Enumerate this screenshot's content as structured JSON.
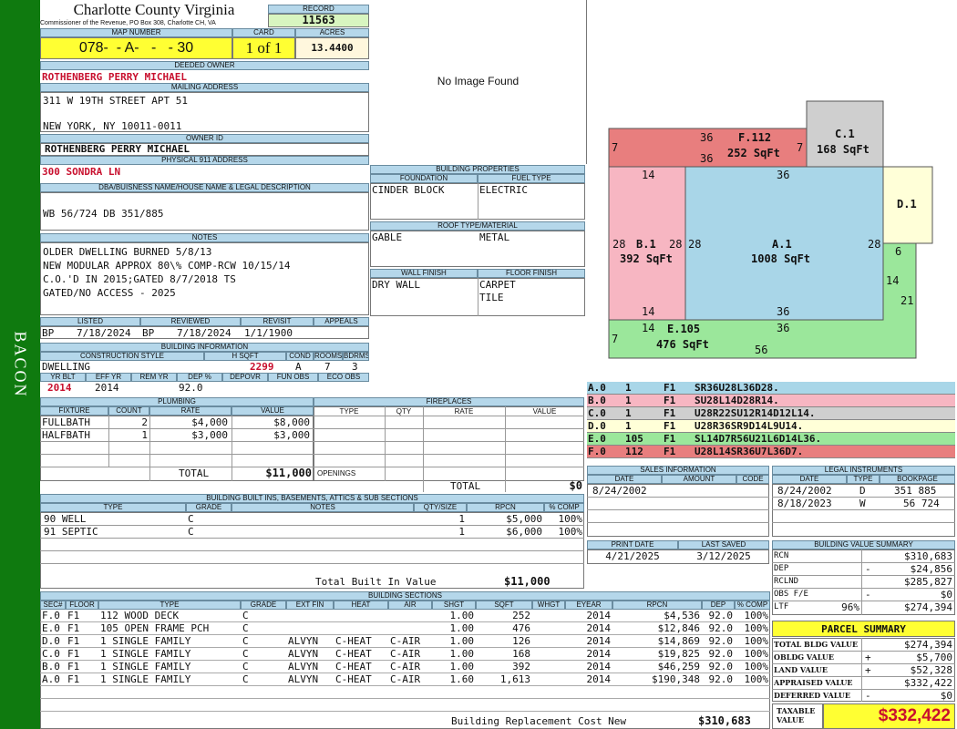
{
  "sidebar_label": "BACON",
  "county": {
    "title": "Charlotte County Virginia",
    "subtitle": "Commissioner of the Revenue, PO Box 308, Charlotte CH, VA"
  },
  "record": {
    "label": "RECORD",
    "value": "11563"
  },
  "map": {
    "label": "MAP NUMBER",
    "value": "078-  - A-   -   - 30",
    "card_label": "CARD",
    "card_value": "1 of 1",
    "acres_label": "ACRES",
    "acres_value": "13.4400"
  },
  "deeded_owner": {
    "label": "DEEDED OWNER",
    "value": "ROTHENBERG PERRY MICHAEL"
  },
  "mailing": {
    "label": "MAILING ADDRESS",
    "line1": "311 W 19TH STREET APT 51",
    "line2": "NEW YORK, NY 10011-0011"
  },
  "owner_id": {
    "label": "OWNER ID",
    "value": "ROTHENBERG PERRY MICHAEL"
  },
  "physical": {
    "label": "PHYSICAL 911 ADDRESS",
    "value": "300 SONDRA LN"
  },
  "dba": {
    "label": "DBA/BUISNESS NAME/HOUSE NAME & LEGAL DESCRIPTION",
    "value": "WB 56/724 DB 351/885"
  },
  "notes": {
    "label": "NOTES",
    "lines": [
      "OLDER DWELLING BURNED 5/8/13",
      "NEW MODULAR APPROX 80\\% COMP-RCW 10/15/14",
      "C.O.'D IN 2015;GATED 8/7/2018 TS",
      "GATED/NO ACCESS - 2025"
    ]
  },
  "listed": {
    "labels": [
      "LISTED",
      "REVIEWED",
      "REVISIT",
      "APPEALS"
    ],
    "listed_by": "BP",
    "listed_date": "7/18/2024",
    "reviewed_by": "BP",
    "reviewed_date": "7/18/2024",
    "revisit": "1/1/1900",
    "appeals": ""
  },
  "building_info": {
    "label": "BUILDING INFORMATION",
    "h_construction": "CONSTRUCTION STYLE",
    "h_hsqft": "H SQFT",
    "h_cond": "COND",
    "h_rooms": "ROOMS",
    "h_bdrms": "BDRMS",
    "style": "DWELLING",
    "hsqft": "2299",
    "cond": "A",
    "rooms": "7",
    "bdrms": "3",
    "h_yrblt": "YR BLT",
    "h_effyr": "EFF YR",
    "h_remyr": "REM YR",
    "h_dep": "DEP %",
    "h_depovr": "DEPOVR",
    "h_funobs": "FUN OBS",
    "h_ecoobs": "ECO OBS",
    "yrblt": "2014",
    "effyr": "2014",
    "remyr": "",
    "dep": "92.0",
    "depovr": "",
    "funobs": "",
    "ecoobs": ""
  },
  "plumbing": {
    "label": "PLUMBING",
    "headers": [
      "FIXTURE",
      "COUNT",
      "RATE",
      "VALUE"
    ],
    "rows": [
      [
        "FULLBATH",
        "2",
        "$4,000",
        "$8,000"
      ],
      [
        "HALFBATH",
        "1",
        "$3,000",
        "$3,000"
      ]
    ],
    "total_label": "TOTAL",
    "total": "$11,000"
  },
  "fireplaces": {
    "label": "FIREPLACES",
    "headers": [
      "TYPE",
      "QTY",
      "RATE",
      "VALUE"
    ],
    "openings_label": "OPENINGS",
    "total_label": "TOTAL",
    "total": "$0"
  },
  "photo": {
    "text": "No Image Found"
  },
  "building_props": {
    "label": "BUILDING PROPERTIES",
    "h_foundation": "FOUNDATION",
    "h_fuel": "FUEL TYPE",
    "foundation": "CINDER BLOCK",
    "fuel": "ELECTRIC",
    "h_roof": "ROOF TYPE/MATERIAL",
    "roof_type": "GABLE",
    "roof_mat": "METAL",
    "h_wall": "WALL FINISH",
    "h_floor": "FLOOR FINISH",
    "wall": "DRY WALL",
    "floor1": "CARPET",
    "floor2": "TILE"
  },
  "sketch": {
    "labels": [
      {
        "t": "F.112",
        "b": true
      },
      {
        "t": "252 SqFt",
        "b": true
      },
      {
        "t": "C.1",
        "b": true
      },
      {
        "t": "168 SqFt",
        "b": true
      },
      {
        "t": "D.1",
        "b": true
      },
      {
        "t": "B.1",
        "b": true
      },
      {
        "t": "392 SqFt",
        "b": true
      },
      {
        "t": "A.1",
        "b": true
      },
      {
        "t": "1008 SqFt",
        "b": true
      },
      {
        "t": "E.105",
        "b": true
      },
      {
        "t": "476 SqFt",
        "b": true
      },
      {
        "t": "36"
      },
      {
        "t": "36"
      },
      {
        "t": "7"
      },
      {
        "t": "7"
      },
      {
        "t": "14"
      },
      {
        "t": "36"
      },
      {
        "t": "28"
      },
      {
        "t": "28"
      },
      {
        "t": "28"
      },
      {
        "t": "28"
      },
      {
        "t": "6"
      },
      {
        "t": "14"
      },
      {
        "t": "21"
      },
      {
        "t": "14"
      },
      {
        "t": "36"
      },
      {
        "t": "14"
      },
      {
        "t": "36"
      },
      {
        "t": "7"
      },
      {
        "t": "56"
      }
    ],
    "colors": {
      "F": "#e87e7e",
      "C": "#cfcfcf",
      "D": "#ffffd8",
      "B": "#f7b6c2",
      "A": "#a9d6e8",
      "E": "#9be79b"
    }
  },
  "legend_rows": [
    {
      "code": "A.0",
      "n": "1",
      "fl": "F1",
      "desc": "SR36U28L36D28.",
      "color": "#a9d6e8"
    },
    {
      "code": "B.0",
      "n": "1",
      "fl": "F1",
      "desc": "SU28L14D28R14.",
      "color": "#f7b6c2"
    },
    {
      "code": "C.0",
      "n": "1",
      "fl": "F1",
      "desc": "U28R22SU12R14D12L14.",
      "color": "#cfcfcf"
    },
    {
      "code": "D.0",
      "n": "1",
      "fl": "F1",
      "desc": "U28R36SR9D14L9U14.",
      "color": "#ffffd8"
    },
    {
      "code": "E.0",
      "n": "105",
      "fl": "F1",
      "desc": "SL14D7R56U21L6D14L36.",
      "color": "#9be79b"
    },
    {
      "code": "F.0",
      "n": "112",
      "fl": "F1",
      "desc": "U28L14SR36U7L36D7.",
      "color": "#e87e7e"
    }
  ],
  "sales": {
    "label": "SALES INFORMATION",
    "headers": [
      "DATE",
      "AMOUNT",
      "CODE"
    ],
    "rows": [
      [
        "8/24/2002",
        "",
        ""
      ]
    ]
  },
  "legal": {
    "label": "LEGAL INSTRUMENTS",
    "headers": [
      "DATE",
      "TYPE",
      "BOOKPAGE"
    ],
    "rows": [
      [
        "8/24/2002",
        "D",
        "351 885"
      ],
      [
        "8/18/2023",
        "W",
        "56 724"
      ]
    ]
  },
  "print": {
    "h_print": "PRINT DATE",
    "h_saved": "LAST SAVED",
    "print": "4/21/2025",
    "saved": "3/12/2025"
  },
  "bvs": {
    "label": "BUILDING VALUE SUMMARY",
    "rows": [
      [
        "RCN",
        "",
        "$310,683"
      ],
      [
        "DEP",
        "-",
        "$24,856"
      ],
      [
        "RCLND",
        "",
        "$285,827"
      ],
      [
        "OBS F/E",
        "-",
        "$0"
      ],
      [
        "LTF",
        "96%",
        "$274,394"
      ]
    ]
  },
  "parcel": {
    "label": "PARCEL SUMMARY",
    "rows": [
      [
        "TOTAL BLDG VALUE",
        "",
        "$274,394"
      ],
      [
        "OBLDG VALUE",
        "+",
        "$5,700"
      ],
      [
        "LAND VALUE",
        "+",
        "$52,328"
      ],
      [
        "APPRAISED VALUE",
        "",
        "$332,422"
      ],
      [
        "DEFERRED VALUE",
        "-",
        "$0"
      ]
    ],
    "taxable_label1": "TAXABLE",
    "taxable_label2": "VALUE",
    "taxable": "$332,422"
  },
  "builtins": {
    "label": "BUILDING BUILT INS, BASEMENTS, ATTICS & SUB SECTIONS",
    "headers": [
      "TYPE",
      "GRADE",
      "NOTES",
      "QTY/SIZE",
      "RPCN",
      "% COMP"
    ],
    "rows": [
      [
        "90 WELL",
        "C",
        "",
        "1",
        "$5,000",
        "100%"
      ],
      [
        "91 SEPTIC",
        "C",
        "",
        "1",
        "$6,000",
        "100%"
      ]
    ],
    "total_label": "Total Built In Value",
    "total": "$11,000"
  },
  "sections": {
    "label": "BUILDING SECTIONS",
    "headers": [
      "SEC#",
      "FLOOR",
      "TYPE",
      "GRADE",
      "EXT FIN",
      "HEAT",
      "AIR",
      "SHGT",
      "SQFT",
      "WHGT",
      "EYEAR",
      "RPCN",
      "DEP",
      "% COMP"
    ],
    "rows": [
      [
        "F.0",
        "F1",
        "112 WOOD DECK",
        "C",
        "",
        "",
        "",
        "1.00",
        "252",
        "",
        "2014",
        "$4,536",
        "92.0",
        "100%"
      ],
      [
        "E.0",
        "F1",
        "105 OPEN FRAME PCH",
        "C",
        "",
        "",
        "",
        "1.00",
        "476",
        "",
        "2014",
        "$12,846",
        "92.0",
        "100%"
      ],
      [
        "D.0",
        "F1",
        "1 SINGLE FAMILY",
        "C",
        "ALVYN",
        "C-HEAT",
        "C-AIR",
        "1.00",
        "126",
        "",
        "2014",
        "$14,869",
        "92.0",
        "100%"
      ],
      [
        "C.0",
        "F1",
        "1 SINGLE FAMILY",
        "C",
        "ALVYN",
        "C-HEAT",
        "C-AIR",
        "1.00",
        "168",
        "",
        "2014",
        "$19,825",
        "92.0",
        "100%"
      ],
      [
        "B.0",
        "F1",
        "1 SINGLE FAMILY",
        "C",
        "ALVYN",
        "C-HEAT",
        "C-AIR",
        "1.00",
        "392",
        "",
        "2014",
        "$46,259",
        "92.0",
        "100%"
      ],
      [
        "A.0",
        "F1",
        "1 SINGLE FAMILY",
        "C",
        "ALVYN",
        "C-HEAT",
        "C-AIR",
        "1.60",
        "1,613",
        "",
        "2014",
        "$190,348",
        "92.0",
        "100%"
      ]
    ],
    "total_label": "Building Replacement Cost New",
    "total": "$310,683"
  }
}
